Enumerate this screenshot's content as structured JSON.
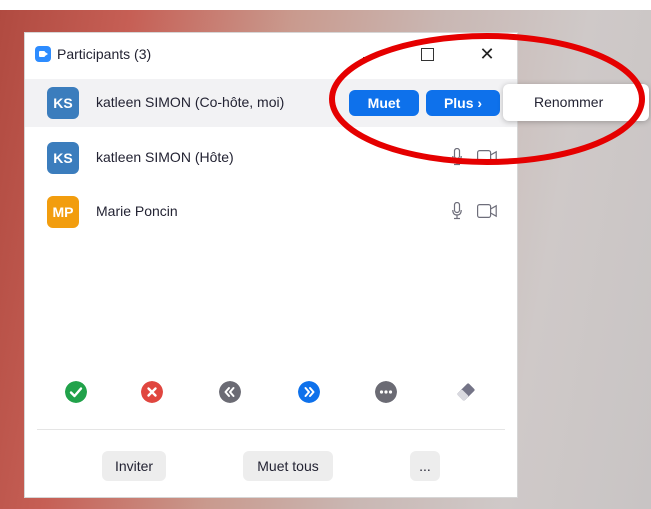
{
  "window": {
    "title": "Participants (3)"
  },
  "participants": [
    {
      "initials": "KS",
      "name": "katleen SIMON (Co-hôte, moi)",
      "avatar_color": "#3b7dbd",
      "mute_label": "Muet",
      "more_label": "Plus ›"
    },
    {
      "initials": "KS",
      "name": "katleen SIMON (Hôte)",
      "avatar_color": "#3b7dbd"
    },
    {
      "initials": "MP",
      "name": "Marie Poncin",
      "avatar_color": "#f29d0e"
    }
  ],
  "context_menu": {
    "items": [
      "Renommer"
    ]
  },
  "actions": [
    {
      "icon": "check-icon",
      "color": "#21a24a"
    },
    {
      "icon": "x-icon",
      "color": "#e0463f"
    },
    {
      "icon": "rewind-icon",
      "color": "#6b6b74"
    },
    {
      "icon": "fast-forward-icon",
      "color": "#0e71eb"
    },
    {
      "icon": "more-icon",
      "color": "#6b6b74"
    },
    {
      "icon": "eraser-icon",
      "color": "#747487"
    }
  ],
  "footer": {
    "invite_label": "Inviter",
    "mute_all_label": "Muet tous",
    "more_label": "..."
  },
  "colors": {
    "accent": "#0e71eb",
    "annotation": "#e50000"
  }
}
